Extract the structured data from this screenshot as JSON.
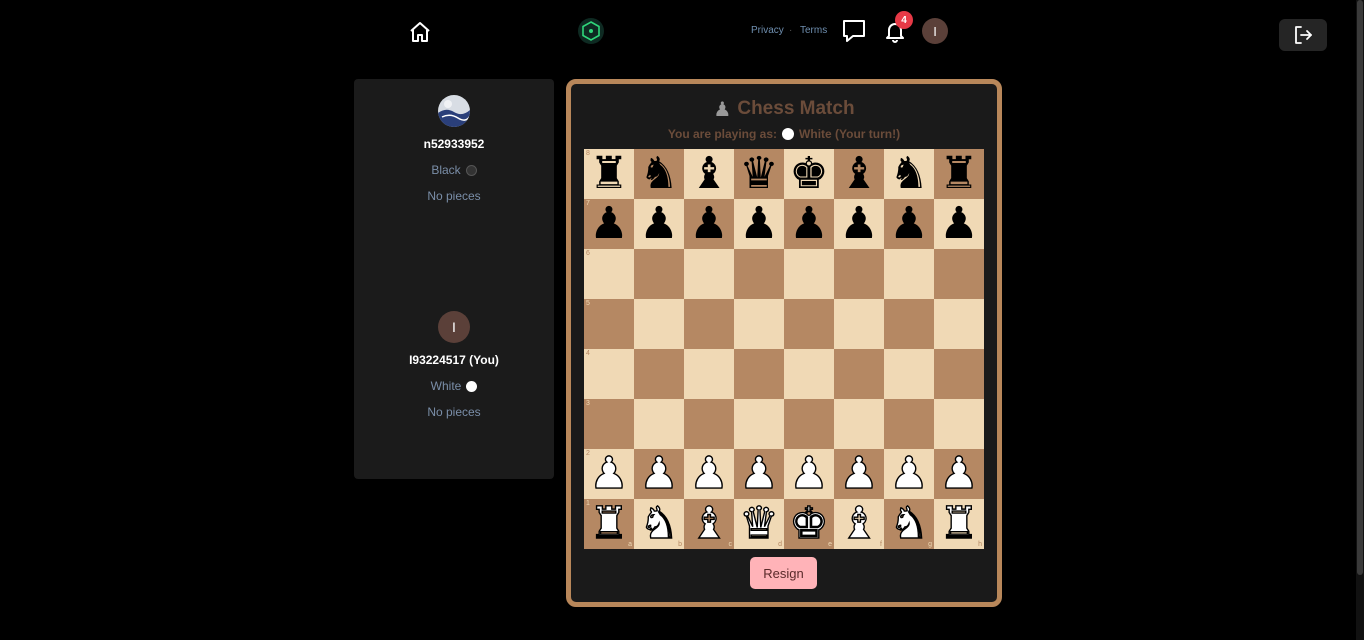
{
  "nav": {
    "privacy_label": "Privacy",
    "separator": "·",
    "terms_label": "Terms",
    "notification_count": "4",
    "avatar_letter": "I"
  },
  "players": {
    "opponent": {
      "name": "n52933952",
      "color_label": "Black",
      "pieces_label": "No pieces"
    },
    "self": {
      "avatar_letter": "I",
      "name": "I93224517 (You)",
      "color_label": "White",
      "pieces_label": "No pieces"
    }
  },
  "game": {
    "title": "Chess Match",
    "status_prefix": "You are playing as:",
    "status_suffix": "White (Your turn!)",
    "resign_label": "Resign"
  },
  "board": {
    "ranks": [
      "8",
      "7",
      "6",
      "5",
      "4",
      "3",
      "2",
      "1"
    ],
    "files": [
      "a",
      "b",
      "c",
      "d",
      "e",
      "f",
      "g",
      "h"
    ],
    "rows": [
      [
        "br",
        "bn",
        "bb",
        "bq",
        "bk",
        "bb",
        "bn",
        "br"
      ],
      [
        "bp",
        "bp",
        "bp",
        "bp",
        "bp",
        "bp",
        "bp",
        "bp"
      ],
      [
        "",
        "",
        "",
        "",
        "",
        "",
        "",
        ""
      ],
      [
        "",
        "",
        "",
        "",
        "",
        "",
        "",
        ""
      ],
      [
        "",
        "",
        "",
        "",
        "",
        "",
        "",
        ""
      ],
      [
        "",
        "",
        "",
        "",
        "",
        "",
        "",
        ""
      ],
      [
        "wp",
        "wp",
        "wp",
        "wp",
        "wp",
        "wp",
        "wp",
        "wp"
      ],
      [
        "wr",
        "wn",
        "wb",
        "wq",
        "wk",
        "wb",
        "wn",
        "wr"
      ]
    ]
  },
  "colors": {
    "board_light": "#f0d9b5",
    "board_dark": "#b58863",
    "card_border": "#b8875a",
    "resign_bg": "#ffb3b8",
    "badge": "#e63946"
  }
}
